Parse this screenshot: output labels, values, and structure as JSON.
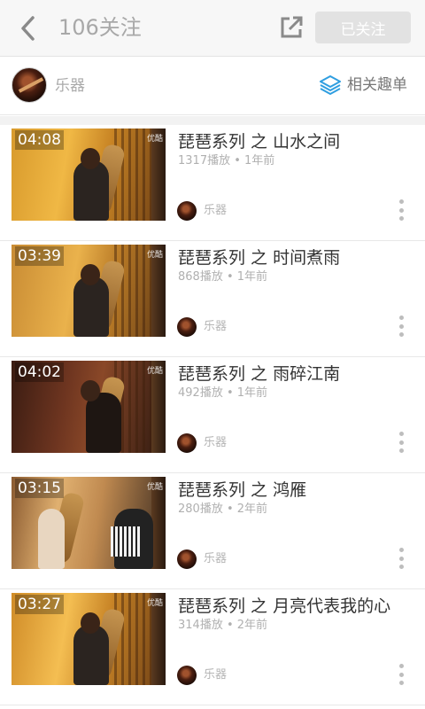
{
  "header": {
    "title": "106关注",
    "follow_label": "已关注",
    "icons": {
      "back": "chevron-left-icon",
      "share": "external-share-icon"
    }
  },
  "channel": {
    "name": "乐器",
    "related_label": "相关趣单",
    "related_icon": "layers-icon",
    "accent": "#2f9ee0"
  },
  "videos": [
    {
      "duration": "04:08",
      "title": "琵琶系列 之 山水之间",
      "meta": "1317播放 • 1年前",
      "channel": "乐器",
      "watermark": "优酷"
    },
    {
      "duration": "03:39",
      "title": "琵琶系列 之 时间煮雨",
      "meta": "868播放 • 1年前",
      "channel": "乐器",
      "watermark": "优酷"
    },
    {
      "duration": "04:02",
      "title": "琵琶系列 之 雨碎江南",
      "meta": "492播放 • 1年前",
      "channel": "乐器",
      "watermark": "优酷"
    },
    {
      "duration": "03:15",
      "title": "琵琶系列 之 鸿雁",
      "meta": "280播放 • 2年前",
      "channel": "乐器",
      "watermark": "优酷"
    },
    {
      "duration": "03:27",
      "title": "琵琶系列 之 月亮代表我的心",
      "meta": "314播放 • 2年前",
      "channel": "乐器",
      "watermark": "优酷"
    }
  ]
}
